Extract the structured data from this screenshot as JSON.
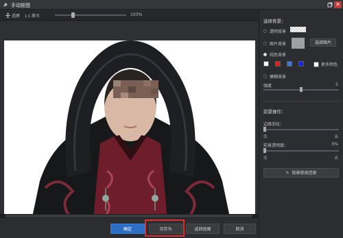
{
  "window": {
    "title": "手动抠图"
  },
  "toolbar": {
    "fit_label": "适屏",
    "original_label": "原大",
    "zoom_value": "103%",
    "zoom_fraction": 0.25
  },
  "buttons": {
    "confirm": "确定",
    "save_as": "另存为",
    "restore_cut": "返回抠图",
    "cancel": "取消"
  },
  "panel": {
    "select_bg_title": "选择背景：",
    "bg_options": {
      "transparent": "透明背景",
      "image": "图片背景",
      "pure_color": "纯色背景",
      "blur": "模糊背景"
    },
    "pick_image": "选择图片",
    "more_colors": "更多颜色",
    "swatches": [
      "#ffffff",
      "#e51c1c",
      "#3a78d6",
      "#1424e8"
    ],
    "strength_label": "强度",
    "strength_value": "5",
    "strength_fraction": 0.5,
    "foreground_title": "前景操作：",
    "edge_feather_label": "边缘羽化：",
    "edge_feather": {
      "low": "低",
      "high": "高"
    },
    "fg_opacity_label": "前景透明度：",
    "fg_opacity_value": "0%",
    "fg_opacity": {
      "low": "低",
      "high": "高"
    },
    "restore_fg_label": "前景修改还原"
  },
  "colors": {
    "accent": "#2d6fc4",
    "highlight": "#e0302b",
    "close": "#c43a35"
  }
}
